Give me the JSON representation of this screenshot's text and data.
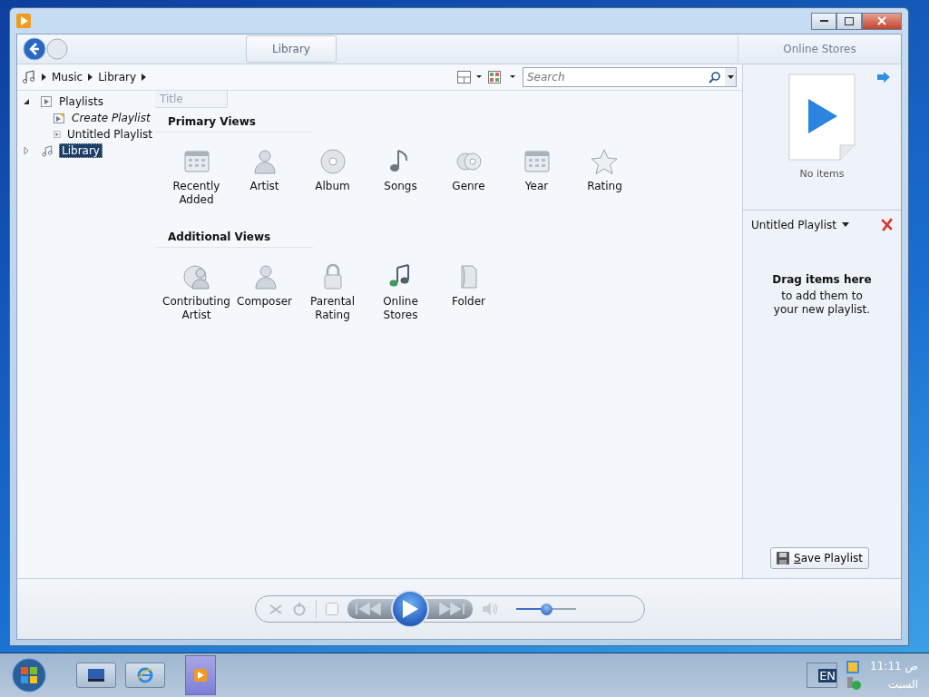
{
  "tabs": [
    {
      "label": "Library",
      "selected": true
    },
    {
      "label": "Online Stores",
      "selected": false
    }
  ],
  "breadcrumb": [
    "Music",
    "Library"
  ],
  "search": {
    "placeholder": "Search"
  },
  "nav_tree": [
    {
      "label": "Playlists",
      "kind": "folder",
      "expanded": true,
      "selected": false,
      "children": [
        {
          "label": "Create Playlist",
          "kind": "action",
          "selected": false
        },
        {
          "label": "Untitled Playlist",
          "kind": "playlist",
          "selected": false
        }
      ]
    },
    {
      "label": "Library",
      "kind": "music",
      "expanded": false,
      "selected": true
    }
  ],
  "column_header": "Title",
  "sections": [
    {
      "title": "Primary Views",
      "views": [
        {
          "label": "Recently Added",
          "kind": "calendar"
        },
        {
          "label": "Artist",
          "kind": "person"
        },
        {
          "label": "Album",
          "kind": "disc"
        },
        {
          "label": "Songs",
          "kind": "note"
        },
        {
          "label": "Genre",
          "kind": "discs"
        },
        {
          "label": "Year",
          "kind": "calendar"
        },
        {
          "label": "Rating",
          "kind": "star"
        }
      ]
    },
    {
      "title": "Additional Views",
      "views": [
        {
          "label": "Contributing Artist",
          "kind": "person-disc"
        },
        {
          "label": "Composer",
          "kind": "person"
        },
        {
          "label": "Parental Rating",
          "kind": "lock"
        },
        {
          "label": "Online Stores",
          "kind": "note-green"
        },
        {
          "label": "Folder",
          "kind": "folder"
        }
      ]
    }
  ],
  "list_pane": {
    "status": "No items",
    "playlist_title": "Untitled Playlist",
    "drag_title": "Drag items here",
    "drag_hint": "to add them to your new playlist.",
    "save_button": "Save Playlist"
  },
  "player": {
    "volume": {
      "level": 0.5
    }
  },
  "taskbar": {
    "language": "EN",
    "time": "11:11 ص",
    "day": "السبت"
  }
}
